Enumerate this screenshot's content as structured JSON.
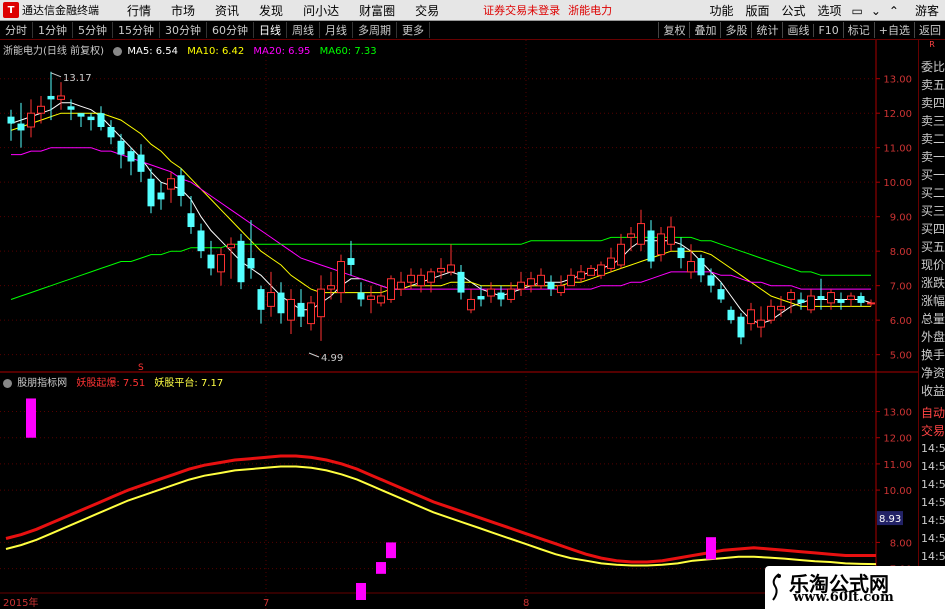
{
  "app": {
    "title": "通达信金融终端",
    "logo_glyph": "T",
    "menu": [
      "行情",
      "市场",
      "资讯",
      "发现",
      "问小达",
      "财富圈",
      "交易"
    ],
    "login_status": "证券交易未登录",
    "stock_tag": "浙能电力",
    "right_menu": [
      "功能",
      "版面",
      "公式",
      "选项"
    ],
    "guest": "游客"
  },
  "periods": {
    "tabs": [
      "分时",
      "1分钟",
      "5分钟",
      "15分钟",
      "30分钟",
      "60分钟",
      "日线",
      "周线",
      "月线",
      "多周期",
      "更多"
    ],
    "active": "日线",
    "tools": [
      "复权",
      "叠加",
      "多股",
      "统计",
      "画线",
      "F10",
      "标记",
      "+自选",
      "返回"
    ]
  },
  "price_header": {
    "stock": "浙能电力(日线 前复权)",
    "ma5": "MA5: 6.54",
    "ma10": "MA10: 6.42",
    "ma20": "MA20: 6.95",
    "ma60": "MA60: 7.33"
  },
  "indicator_header": {
    "name": "股朋指标网",
    "line1": "妖股起爆: 7.51",
    "line2": "妖股平台: 7.17"
  },
  "price_axis": [
    "13.00",
    "12.00",
    "11.00",
    "10.00",
    "9.00",
    "8.00",
    "7.00",
    "6.00",
    "5.00"
  ],
  "ind_axis": [
    "13.00",
    "12.00",
    "11.00",
    "10.00",
    "8.00",
    "7.00"
  ],
  "ind_current": "8.93",
  "annotations": {
    "high": "13.17",
    "low": "4.99",
    "s_marker": "S"
  },
  "x_labels": [
    "2015年",
    "7",
    "8"
  ],
  "quote_panel": {
    "top": "R",
    "labels": [
      "委比",
      "卖五",
      "卖四",
      "卖三",
      "卖二",
      "卖一",
      "买一",
      "买二",
      "买三",
      "买四",
      "买五",
      "现价",
      "涨跌",
      "涨幅",
      "总量",
      "外盘",
      "换手",
      "净资",
      "收益"
    ],
    "lower": [
      "自动",
      "交易"
    ],
    "times": [
      "14:5",
      "14:5",
      "14:5",
      "14:5",
      "14:5",
      "14:5",
      "14:5",
      "14:5",
      "14:5"
    ]
  },
  "watermark": {
    "title": "乐淘公式网",
    "url": "www.60lt.com"
  },
  "colors": {
    "up": "#ff3232",
    "down": "#54ffff",
    "ma5": "#ffffff",
    "ma10": "#ffff00",
    "ma20": "#ff00ff",
    "ma60": "#00ff00",
    "ind_red": "#e81010",
    "ind_yellow": "#ffff40",
    "ind_bar": "#ff00ff"
  },
  "chart_data": {
    "type": "candlestick",
    "candles": [
      [
        11.9,
        11.7,
        12.1,
        11.2
      ],
      [
        11.7,
        11.5,
        12.3,
        11.0
      ],
      [
        11.6,
        12.0,
        12.4,
        11.3
      ],
      [
        12.0,
        12.2,
        12.5,
        11.7
      ],
      [
        12.5,
        12.4,
        13.2,
        11.8
      ],
      [
        12.4,
        12.5,
        12.9,
        12.1
      ],
      [
        12.2,
        12.1,
        12.4,
        11.8
      ],
      [
        12.0,
        11.9,
        12.0,
        11.6
      ],
      [
        11.9,
        11.8,
        12.0,
        11.5
      ],
      [
        12.0,
        11.6,
        12.2,
        11.5
      ],
      [
        11.6,
        11.3,
        11.8,
        11.1
      ],
      [
        11.2,
        10.8,
        11.4,
        10.4
      ],
      [
        10.9,
        10.6,
        11.0,
        10.2
      ],
      [
        10.8,
        10.3,
        11.1,
        10.0
      ],
      [
        10.1,
        9.3,
        10.4,
        9.1
      ],
      [
        9.7,
        9.5,
        10.0,
        9.2
      ],
      [
        9.8,
        10.1,
        10.3,
        9.4
      ],
      [
        10.2,
        9.6,
        10.4,
        9.3
      ],
      [
        9.1,
        8.7,
        9.6,
        8.5
      ],
      [
        8.6,
        8.0,
        8.8,
        7.8
      ],
      [
        7.9,
        7.5,
        8.3,
        7.3
      ],
      [
        7.4,
        7.9,
        8.1,
        7.0
      ],
      [
        8.1,
        8.2,
        8.4,
        7.2
      ],
      [
        8.3,
        7.1,
        8.5,
        6.9
      ],
      [
        7.8,
        7.5,
        8.9,
        7.2
      ],
      [
        6.9,
        6.3,
        7.0,
        5.9
      ],
      [
        6.4,
        6.8,
        7.4,
        6.1
      ],
      [
        6.8,
        6.2,
        7.1,
        5.9
      ],
      [
        6.0,
        6.6,
        6.9,
        5.6
      ],
      [
        6.5,
        6.1,
        6.9,
        5.8
      ],
      [
        5.9,
        6.5,
        6.7,
        5.7
      ],
      [
        6.1,
        6.9,
        7.3,
        5.4
      ],
      [
        6.9,
        7.0,
        7.4,
        6.6
      ],
      [
        6.8,
        7.7,
        7.9,
        6.5
      ],
      [
        7.8,
        7.6,
        8.3,
        7.3
      ],
      [
        6.8,
        6.6,
        7.1,
        6.4
      ],
      [
        6.6,
        6.7,
        7.0,
        6.2
      ],
      [
        6.5,
        6.7,
        7.0,
        6.4
      ],
      [
        6.6,
        7.2,
        7.3,
        6.5
      ],
      [
        6.9,
        7.1,
        7.4,
        6.7
      ],
      [
        7.1,
        7.3,
        7.5,
        6.9
      ],
      [
        7.0,
        7.3,
        7.5,
        6.8
      ],
      [
        7.1,
        7.4,
        7.5,
        6.8
      ],
      [
        7.4,
        7.5,
        7.8,
        7.2
      ],
      [
        7.4,
        7.6,
        8.2,
        7.3
      ],
      [
        7.4,
        6.8,
        7.6,
        6.6
      ],
      [
        6.3,
        6.6,
        6.9,
        6.2
      ],
      [
        6.7,
        6.6,
        7.0,
        6.4
      ],
      [
        6.7,
        6.9,
        7.1,
        6.5
      ],
      [
        6.8,
        6.6,
        7.0,
        6.4
      ],
      [
        6.6,
        6.9,
        7.1,
        6.5
      ],
      [
        6.9,
        7.1,
        7.4,
        6.7
      ],
      [
        7.0,
        7.2,
        7.4,
        6.8
      ],
      [
        7.0,
        7.3,
        7.5,
        6.9
      ],
      [
        7.1,
        6.9,
        7.3,
        6.7
      ],
      [
        6.8,
        7.0,
        7.3,
        6.7
      ],
      [
        7.0,
        7.3,
        7.5,
        7.0
      ],
      [
        7.2,
        7.4,
        7.6,
        7.1
      ],
      [
        7.3,
        7.5,
        7.6,
        7.3
      ],
      [
        7.3,
        7.6,
        7.7,
        7.2
      ],
      [
        7.5,
        7.8,
        8.1,
        7.4
      ],
      [
        7.6,
        8.2,
        8.5,
        7.5
      ],
      [
        8.4,
        8.5,
        8.7,
        8.0
      ],
      [
        8.2,
        8.8,
        9.2,
        8.0
      ],
      [
        8.6,
        7.7,
        8.9,
        7.5
      ],
      [
        7.9,
        8.5,
        8.7,
        7.7
      ],
      [
        8.2,
        8.7,
        9.0,
        8.0
      ],
      [
        8.1,
        7.8,
        8.4,
        7.5
      ],
      [
        7.4,
        7.7,
        8.2,
        7.2
      ],
      [
        7.8,
        7.3,
        7.9,
        7.1
      ],
      [
        7.3,
        7.0,
        7.5,
        6.8
      ],
      [
        6.9,
        6.6,
        7.1,
        6.5
      ],
      [
        6.3,
        6.0,
        6.4,
        5.9
      ],
      [
        6.1,
        5.5,
        6.2,
        5.3
      ],
      [
        5.9,
        6.3,
        6.5,
        5.7
      ],
      [
        5.8,
        6.0,
        6.4,
        5.5
      ],
      [
        6.0,
        6.4,
        6.6,
        5.9
      ],
      [
        6.3,
        6.4,
        6.7,
        6.1
      ],
      [
        6.6,
        6.8,
        6.9,
        6.2
      ],
      [
        6.6,
        6.5,
        6.8,
        6.3
      ],
      [
        6.3,
        6.7,
        6.9,
        6.2
      ],
      [
        6.7,
        6.6,
        7.2,
        6.3
      ],
      [
        6.5,
        6.8,
        6.9,
        6.3
      ],
      [
        6.6,
        6.5,
        6.8,
        6.3
      ],
      [
        6.6,
        6.7,
        6.8,
        6.4
      ],
      [
        6.7,
        6.5,
        6.8,
        6.4
      ],
      [
        6.5,
        6.5,
        6.6,
        6.4
      ]
    ],
    "ma_series": {
      "MA5": [
        11.7,
        11.8,
        11.9,
        12.0,
        12.1,
        12.3,
        12.3,
        12.2,
        12.1,
        11.9,
        11.6,
        11.3,
        11.0,
        10.7,
        10.3,
        10.0,
        9.9,
        9.8,
        9.5,
        9.0,
        8.6,
        8.3,
        8.0,
        7.7,
        7.5,
        7.3,
        7.0,
        6.7,
        6.5,
        6.3,
        6.3,
        6.5,
        6.7,
        7.0,
        7.2,
        7.2,
        7.1,
        7.0,
        6.9,
        6.9,
        7.0,
        7.1,
        7.2,
        7.3,
        7.4,
        7.3,
        7.1,
        6.9,
        6.8,
        6.7,
        6.8,
        6.9,
        7.0,
        7.1,
        7.1,
        7.1,
        7.2,
        7.3,
        7.4,
        7.5,
        7.6,
        7.8,
        8.1,
        8.3,
        8.3,
        8.3,
        8.3,
        8.2,
        8.0,
        7.7,
        7.4,
        7.1,
        6.7,
        6.3,
        6.0,
        5.9,
        6.0,
        6.2,
        6.4,
        6.5,
        6.6,
        6.6,
        6.6,
        6.6,
        6.6,
        6.6,
        6.5
      ],
      "MA10": [
        11.5,
        11.6,
        11.7,
        11.8,
        11.9,
        12.0,
        12.0,
        12.0,
        12.0,
        12.0,
        11.9,
        11.8,
        11.6,
        11.4,
        11.1,
        10.9,
        10.6,
        10.4,
        10.1,
        9.8,
        9.5,
        9.2,
        8.9,
        8.6,
        8.3,
        8.0,
        7.8,
        7.6,
        7.3,
        7.1,
        6.9,
        6.8,
        6.8,
        6.8,
        6.8,
        6.8,
        6.8,
        6.8,
        6.9,
        6.9,
        7.0,
        7.0,
        7.0,
        7.0,
        7.1,
        7.1,
        7.1,
        7.0,
        7.0,
        7.0,
        7.0,
        7.0,
        7.0,
        7.0,
        7.0,
        7.0,
        7.1,
        7.1,
        7.2,
        7.3,
        7.4,
        7.5,
        7.6,
        7.7,
        7.8,
        7.9,
        8.0,
        8.0,
        8.0,
        8.0,
        7.9,
        7.7,
        7.5,
        7.3,
        7.1,
        6.9,
        6.7,
        6.6,
        6.5,
        6.4,
        6.4,
        6.4,
        6.4,
        6.4,
        6.4,
        6.4,
        6.4
      ],
      "MA20": [
        10.8,
        10.8,
        10.9,
        10.9,
        11.0,
        11.0,
        11.0,
        11.0,
        11.0,
        10.9,
        10.9,
        10.8,
        10.7,
        10.6,
        10.5,
        10.4,
        10.3,
        10.1,
        10.0,
        9.8,
        9.6,
        9.4,
        9.2,
        9.0,
        8.8,
        8.6,
        8.4,
        8.2,
        8.0,
        7.8,
        7.7,
        7.6,
        7.5,
        7.4,
        7.3,
        7.2,
        7.1,
        7.0,
        6.9,
        6.9,
        6.9,
        6.9,
        6.9,
        6.9,
        6.9,
        6.9,
        6.9,
        6.9,
        6.9,
        6.9,
        6.9,
        6.9,
        6.9,
        6.9,
        6.9,
        6.9,
        6.9,
        6.9,
        6.9,
        7.0,
        7.0,
        7.0,
        7.1,
        7.1,
        7.2,
        7.3,
        7.4,
        7.4,
        7.4,
        7.4,
        7.4,
        7.3,
        7.3,
        7.2,
        7.1,
        7.1,
        7.0,
        7.0,
        7.0,
        6.9,
        6.9,
        6.9,
        6.9,
        6.9,
        6.9,
        6.9,
        6.9
      ],
      "MA60": [
        6.6,
        6.7,
        6.8,
        6.9,
        7.0,
        7.1,
        7.2,
        7.3,
        7.4,
        7.5,
        7.6,
        7.7,
        7.7,
        7.8,
        7.9,
        7.9,
        8.0,
        8.0,
        8.1,
        8.1,
        8.1,
        8.1,
        8.2,
        8.2,
        8.2,
        8.2,
        8.2,
        8.2,
        8.2,
        8.2,
        8.2,
        8.2,
        8.2,
        8.2,
        8.2,
        8.2,
        8.2,
        8.2,
        8.2,
        8.2,
        8.2,
        8.2,
        8.2,
        8.2,
        8.2,
        8.2,
        8.2,
        8.2,
        8.2,
        8.2,
        8.2,
        8.2,
        8.3,
        8.3,
        8.3,
        8.3,
        8.3,
        8.3,
        8.3,
        8.3,
        8.4,
        8.4,
        8.4,
        8.4,
        8.4,
        8.4,
        8.4,
        8.4,
        8.4,
        8.3,
        8.3,
        8.2,
        8.1,
        8.0,
        7.9,
        7.8,
        7.7,
        7.6,
        7.5,
        7.4,
        7.4,
        7.3,
        7.3,
        7.3,
        7.3,
        7.3,
        7.3
      ]
    },
    "y_range": [
      4.7,
      13.6
    ],
    "indicator": {
      "y_range": [
        5.8,
        13.9
      ],
      "red": [
        8.15,
        8.3,
        8.5,
        8.75,
        9.0,
        9.25,
        9.5,
        9.75,
        10.0,
        10.2,
        10.4,
        10.6,
        10.8,
        10.95,
        11.05,
        11.15,
        11.2,
        11.25,
        11.3,
        11.3,
        11.25,
        11.15,
        11.0,
        10.8,
        10.55,
        10.3,
        10.05,
        9.8,
        9.55,
        9.35,
        9.15,
        8.95,
        8.75,
        8.55,
        8.35,
        8.15,
        7.95,
        7.75,
        7.55,
        7.4,
        7.3,
        7.25,
        7.25,
        7.3,
        7.4,
        7.5,
        7.6,
        7.7,
        7.75,
        7.8,
        7.75,
        7.7,
        7.65,
        7.6,
        7.55,
        7.5,
        7.5,
        7.5
      ],
      "yellow": [
        7.75,
        7.9,
        8.1,
        8.35,
        8.6,
        8.85,
        9.1,
        9.35,
        9.6,
        9.8,
        10.0,
        10.2,
        10.4,
        10.55,
        10.65,
        10.75,
        10.8,
        10.85,
        10.9,
        10.9,
        10.85,
        10.75,
        10.6,
        10.4,
        10.15,
        9.9,
        9.65,
        9.4,
        9.15,
        8.95,
        8.75,
        8.55,
        8.35,
        8.15,
        7.95,
        7.75,
        7.55,
        7.4,
        7.3,
        7.2,
        7.15,
        7.12,
        7.12,
        7.15,
        7.2,
        7.3,
        7.35,
        7.4,
        7.45,
        7.45,
        7.42,
        7.38,
        7.33,
        7.28,
        7.25,
        7.2,
        7.18,
        7.17
      ],
      "bars": [
        [
          2,
          13.5,
          12.0
        ],
        [
          38,
          8.0,
          7.4
        ],
        [
          37,
          7.25,
          6.8
        ],
        [
          35,
          6.45,
          5.8
        ],
        [
          70,
          8.2,
          7.35
        ],
        [
          86,
          6.4,
          5.8
        ]
      ]
    }
  }
}
